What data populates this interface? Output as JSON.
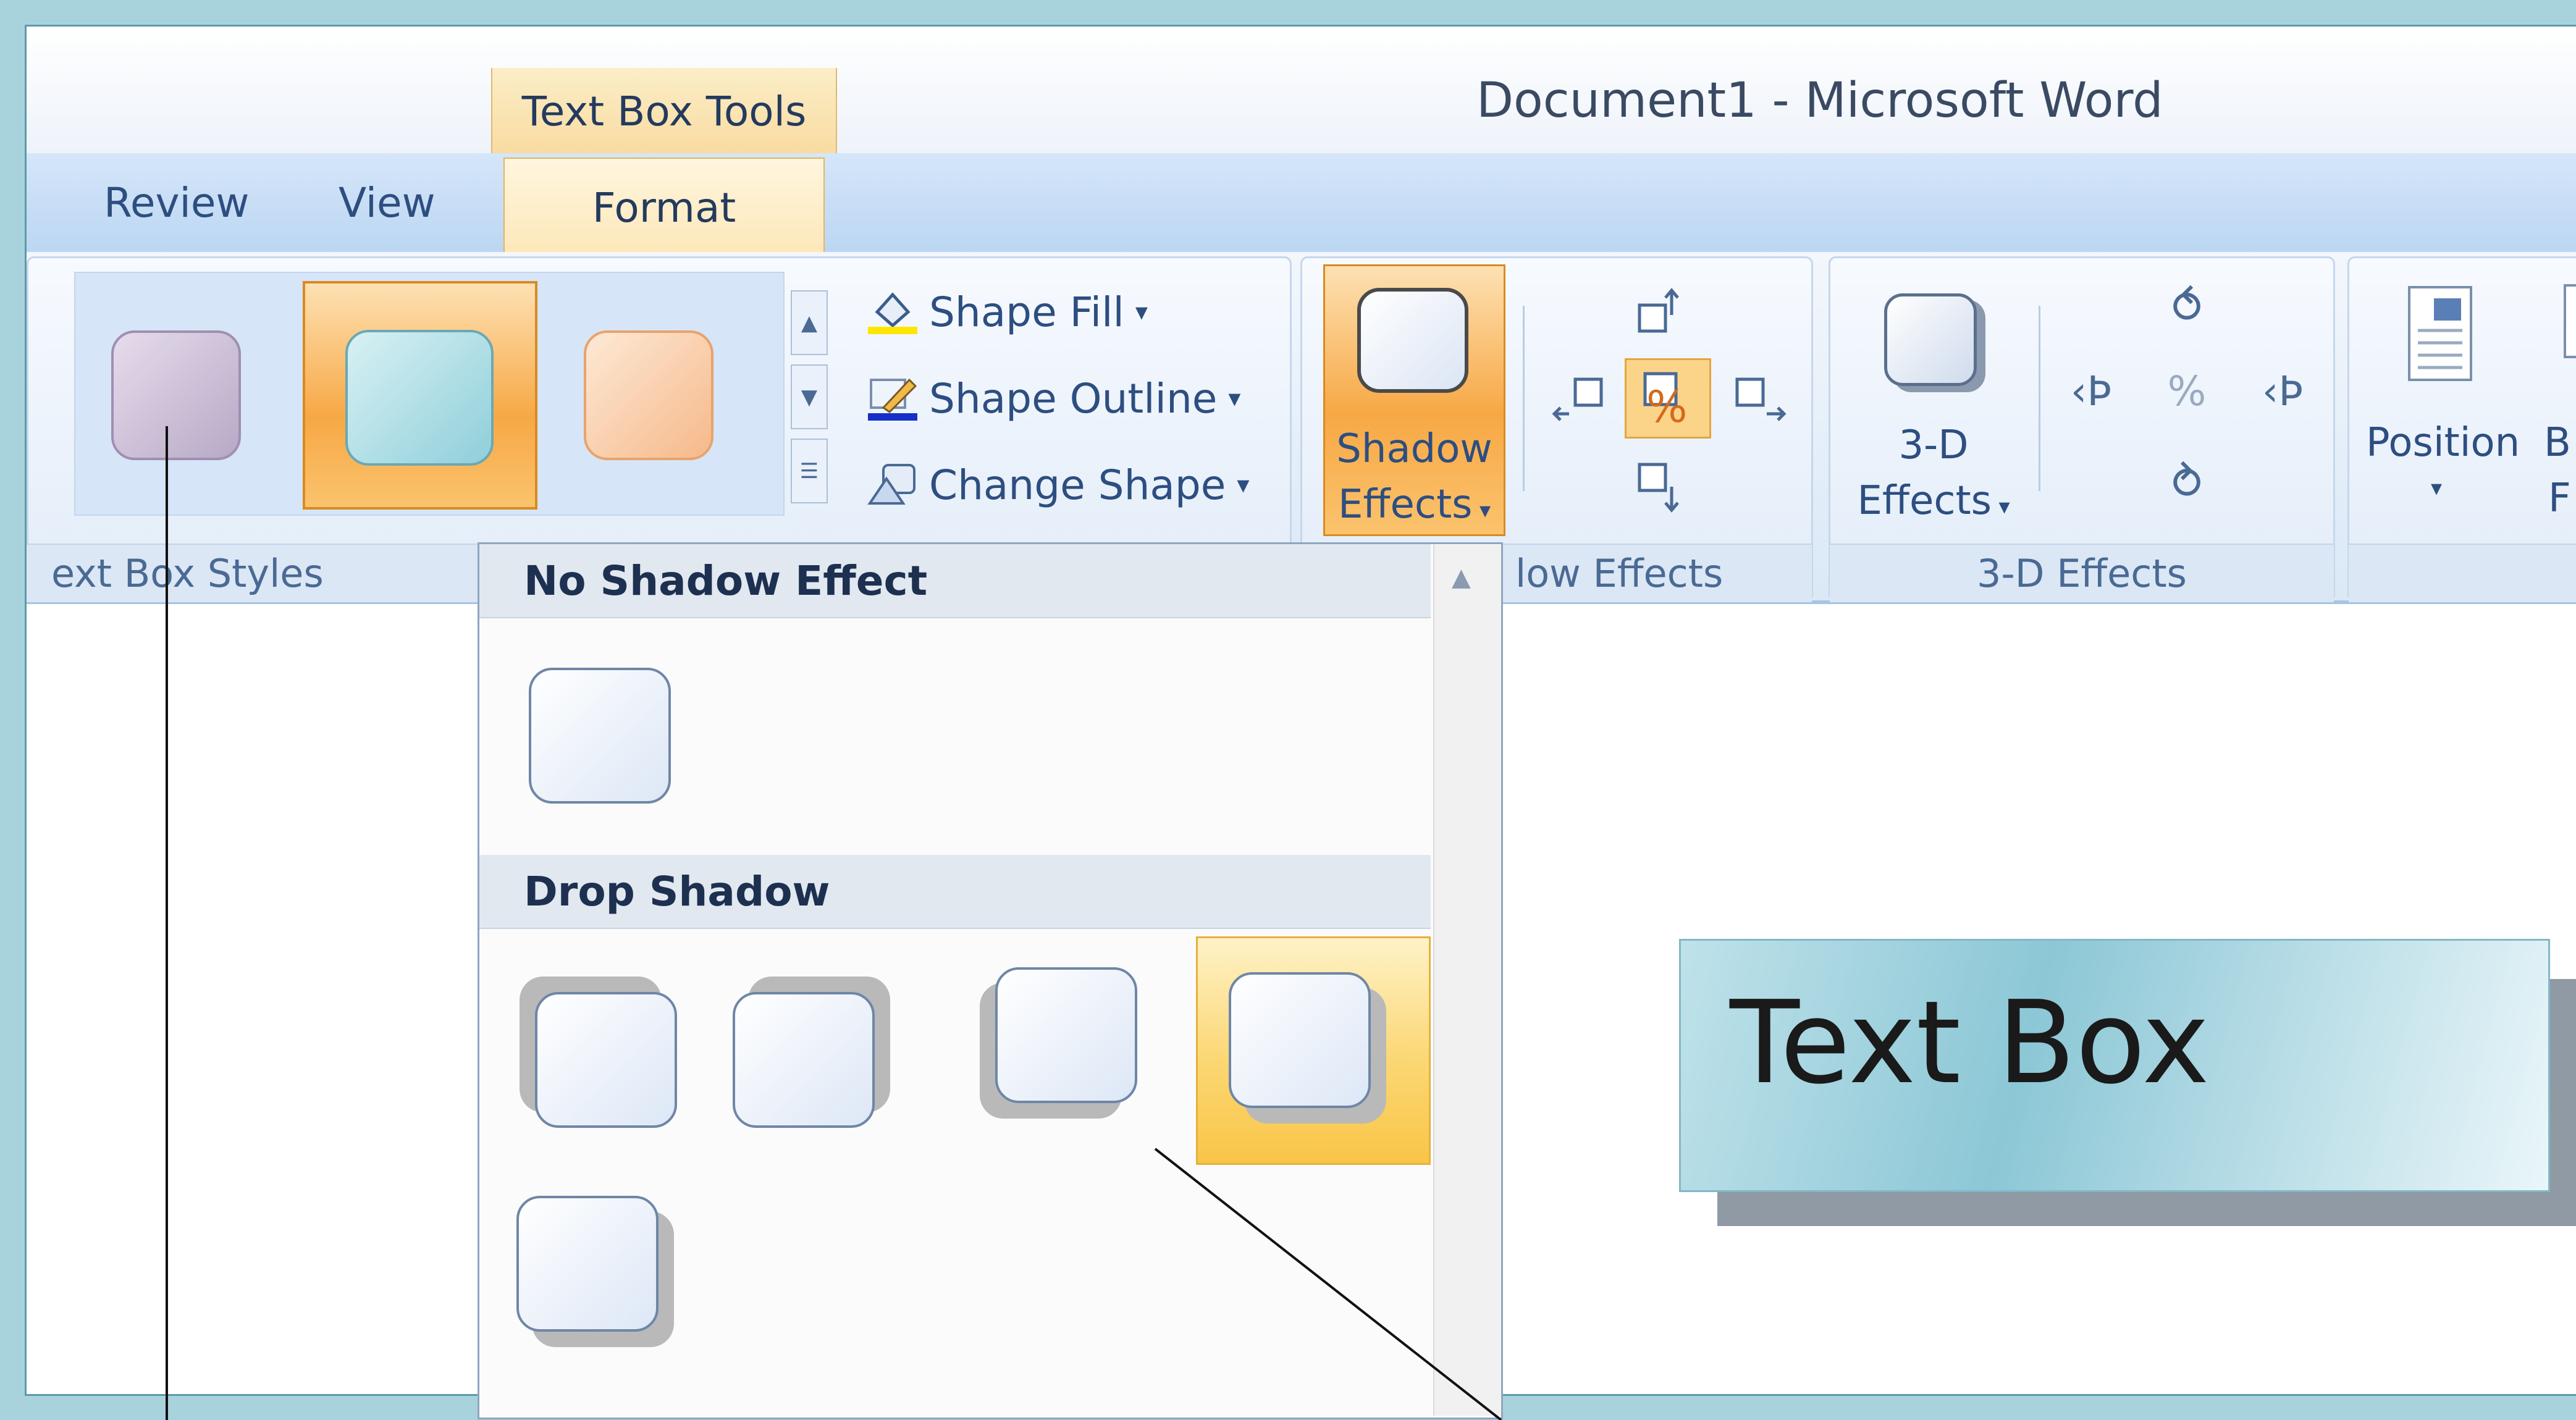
{
  "title_bar": {
    "contextual_tab_label": "Text Box Tools",
    "document_title": "Document1 - Microsoft Word"
  },
  "tabs": [
    {
      "label": "Review"
    },
    {
      "label": "View"
    },
    {
      "label": "Format",
      "active": true
    }
  ],
  "ribbon": {
    "text_box_styles": {
      "group_label": "ext Box Styles",
      "commands": [
        {
          "label": "Shape Fill",
          "icon": "paint-bucket-icon"
        },
        {
          "label": "Shape Outline",
          "icon": "pencil-outline-icon"
        },
        {
          "label": "Change Shape",
          "icon": "change-shape-icon"
        }
      ]
    },
    "shadow_effects": {
      "button_line1": "Shadow",
      "button_line2": "Effects",
      "group_label": "low Effects"
    },
    "three_d_effects": {
      "button_line1": "3-D",
      "button_line2": "Effects",
      "group_label": "3-D Effects"
    },
    "arrange": {
      "position_label": "Position",
      "partial_label_1": "B",
      "partial_label_2": "F"
    }
  },
  "shadow_gallery": {
    "sections": [
      {
        "title": "No Shadow Effect",
        "item_count": 1
      },
      {
        "title": "Drop Shadow",
        "item_count": 5,
        "selected_index": 3
      }
    ]
  },
  "document": {
    "text_box_content": "Text Box"
  },
  "colors": {
    "ribbon_blue": "#bcd6f3",
    "active_orange": "#f7a845",
    "frame_teal": "#a9d3dc",
    "text_blue": "#2d4e80"
  }
}
